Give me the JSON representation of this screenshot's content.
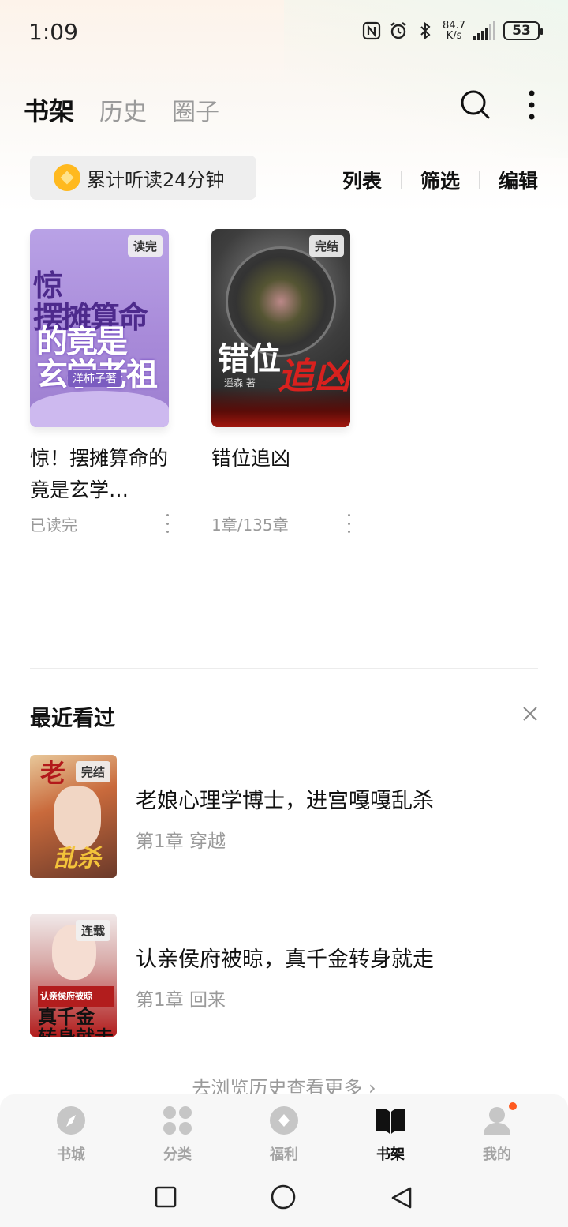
{
  "status_bar": {
    "time": "1:09",
    "net_speed_value": "84.7",
    "net_speed_unit": "K/s",
    "battery": "53",
    "icons": [
      "nfc-icon",
      "alarm-icon",
      "bluetooth-icon",
      "signal-icon",
      "battery-icon"
    ]
  },
  "header": {
    "tabs": [
      {
        "label": "书架",
        "active": true
      },
      {
        "label": "历史",
        "active": false
      },
      {
        "label": "圈子",
        "active": false
      }
    ],
    "search_icon": "search-icon",
    "more_icon": "more-vertical-icon"
  },
  "listen": {
    "icon": "coin-icon",
    "text": "累计听读24分钟"
  },
  "shelf_actions": [
    "列表",
    "筛选",
    "编辑"
  ],
  "shelf": [
    {
      "title": "惊！摆摊算命的竟是玄学…",
      "status_badge": "读完",
      "progress": "已读完",
      "cover_lines": [
        "惊",
        "摆摊算命",
        "的竟是",
        "玄学老祖",
        "洋柿子著"
      ]
    },
    {
      "title": "错位追凶",
      "status_badge": "完结",
      "progress": "1章/135章",
      "cover_lines": [
        "错位",
        "追凶",
        "遥森 著"
      ]
    }
  ],
  "recent": {
    "title": "最近看过",
    "close_icon": "close-icon",
    "items": [
      {
        "title": "老娘心理学博士，进宫嘎嘎乱杀",
        "chapter": "第1章 穿越",
        "status_badge": "完结",
        "cover_lines": [
          "老",
          "乱杀"
        ]
      },
      {
        "title": "认亲侯府被晾，真千金转身就走",
        "chapter": "第1章 回来",
        "status_badge": "连载",
        "cover_lines": [
          "认亲侯府被晾",
          "真千金",
          "转身就走"
        ]
      }
    ],
    "more_link": "去浏览历史查看更多 ›"
  },
  "bottom_nav": [
    {
      "label": "书城",
      "icon": "compass-icon",
      "active": false
    },
    {
      "label": "分类",
      "icon": "grid-icon",
      "active": false
    },
    {
      "label": "福利",
      "icon": "gift-coin-icon",
      "active": false
    },
    {
      "label": "书架",
      "icon": "bookshelf-icon",
      "active": true
    },
    {
      "label": "我的",
      "icon": "profile-icon",
      "active": false,
      "notification_dot": true
    }
  ],
  "system_nav": [
    "recent-apps-icon",
    "home-icon",
    "back-icon"
  ],
  "colors": {
    "accent_dot": "#ff5a1f",
    "coin": "#ffb91f",
    "inactive_text": "#9a9a9a",
    "active_text": "#111111"
  }
}
